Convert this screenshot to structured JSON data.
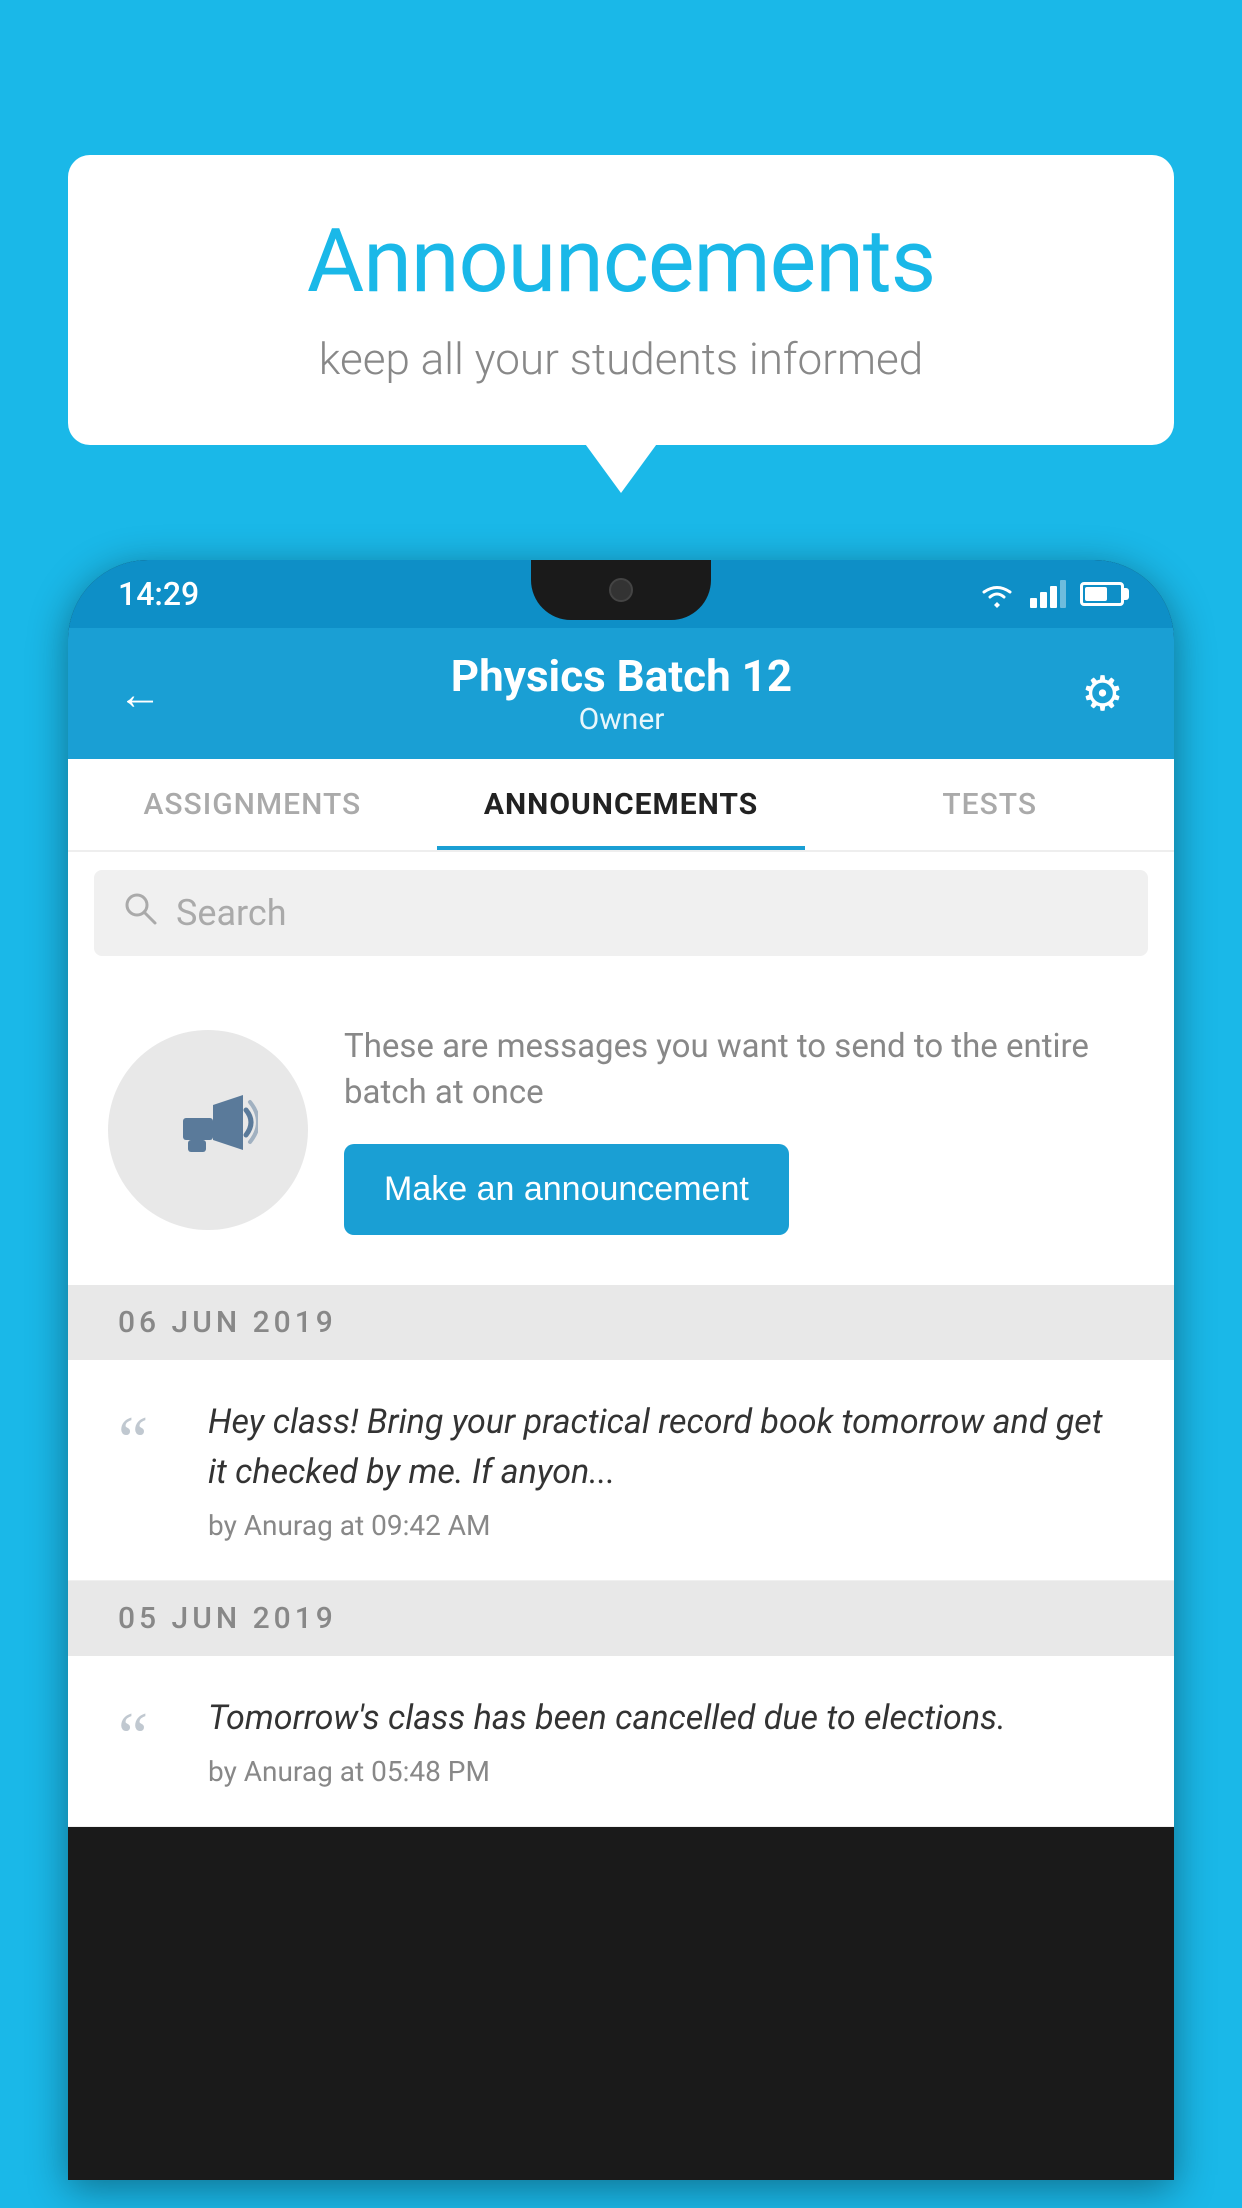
{
  "background_color": "#1ab8e8",
  "bubble": {
    "title": "Announcements",
    "subtitle": "keep all your students informed"
  },
  "phone": {
    "status_bar": {
      "time": "14:29"
    },
    "header": {
      "title": "Physics Batch 12",
      "subtitle": "Owner",
      "back_label": "←",
      "settings_label": "⚙"
    },
    "tabs": [
      {
        "label": "ASSIGNMENTS",
        "active": false
      },
      {
        "label": "ANNOUNCEMENTS",
        "active": true
      },
      {
        "label": "TESTS",
        "active": false
      }
    ],
    "search": {
      "placeholder": "Search"
    },
    "promo": {
      "description": "These are messages you want to send to the entire batch at once",
      "button_label": "Make an announcement"
    },
    "announcements": [
      {
        "date": "06  JUN  2019",
        "message": "Hey class! Bring your practical record book tomorrow and get it checked by me. If anyon...",
        "meta": "by Anurag at 09:42 AM"
      },
      {
        "date": "05  JUN  2019",
        "message": "Tomorrow's class has been cancelled due to elections.",
        "meta": "by Anurag at 05:48 PM"
      }
    ]
  }
}
